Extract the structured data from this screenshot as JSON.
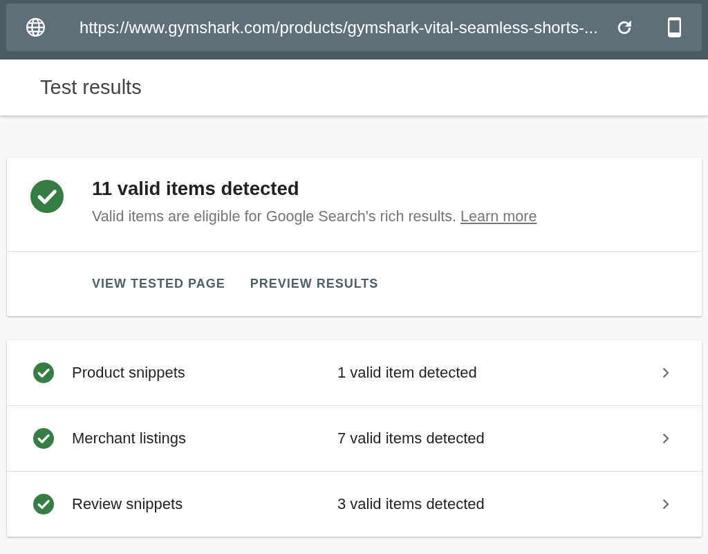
{
  "address_bar": {
    "url": "https://www.gymshark.com/products/gymshark-vital-seamless-shorts-..."
  },
  "header": {
    "title": "Test results"
  },
  "summary": {
    "valid": true,
    "title": "11 valid items detected",
    "description": "Valid items are eligible for Google Search's rich results.",
    "link": "Learn more",
    "actions": [
      "VIEW TESTED PAGE",
      "PREVIEW RESULTS"
    ]
  },
  "results": [
    {
      "valid": true,
      "name": "Product snippets",
      "count": "1 valid item detected"
    },
    {
      "valid": true,
      "name": "Merchant listings",
      "count": "7 valid items detected"
    },
    {
      "valid": true,
      "name": "Review snippets",
      "count": "3 valid items detected"
    }
  ]
}
